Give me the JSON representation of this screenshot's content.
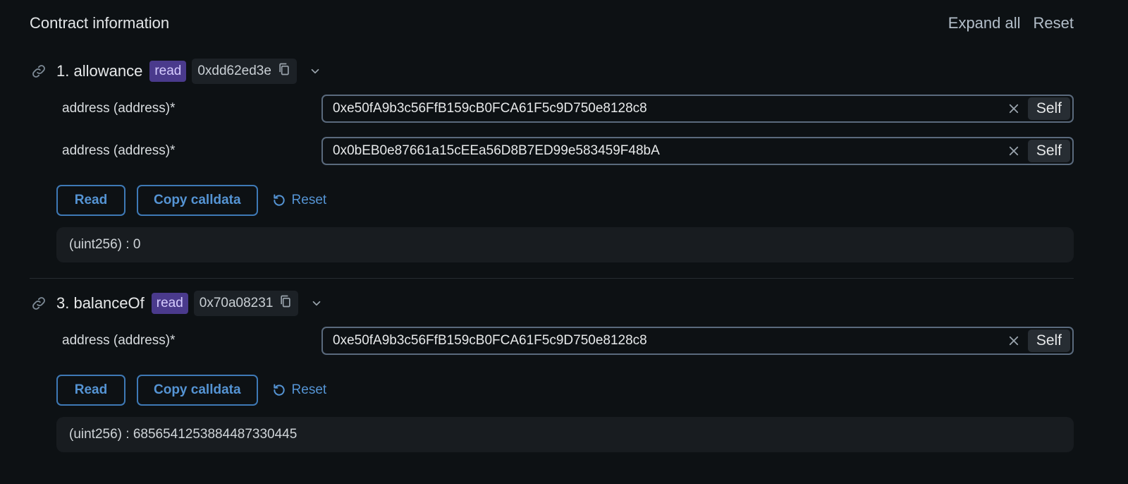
{
  "header": {
    "title": "Contract information",
    "expand_all": "Expand all",
    "reset": "Reset"
  },
  "methods": [
    {
      "name": "1. allowance",
      "badge": "read",
      "selector": "0xdd62ed3e",
      "args": [
        {
          "label": "address (address)*",
          "value": "0xe50fA9b3c56FfB159cB0FCA61F5c9D750e8128c8",
          "self": "Self"
        },
        {
          "label": "address (address)*",
          "value": "0x0bEB0e87661a15cEEa56D8B7ED99e583459F48bA",
          "self": "Self"
        }
      ],
      "read_label": "Read",
      "copy_label": "Copy calldata",
      "reset_label": "Reset",
      "result": "(uint256) : 0"
    },
    {
      "name": "3. balanceOf",
      "badge": "read",
      "selector": "0x70a08231",
      "args": [
        {
          "label": "address (address)*",
          "value": "0xe50fA9b3c56FfB159cB0FCA61F5c9D750e8128c8",
          "self": "Self"
        }
      ],
      "read_label": "Read",
      "copy_label": "Copy calldata",
      "reset_label": "Reset",
      "result": "(uint256) : 6856541253884487330445"
    }
  ],
  "colors": {
    "background": "#0d1114",
    "accent": "#5594d4",
    "badge": "#4a3a8c"
  }
}
